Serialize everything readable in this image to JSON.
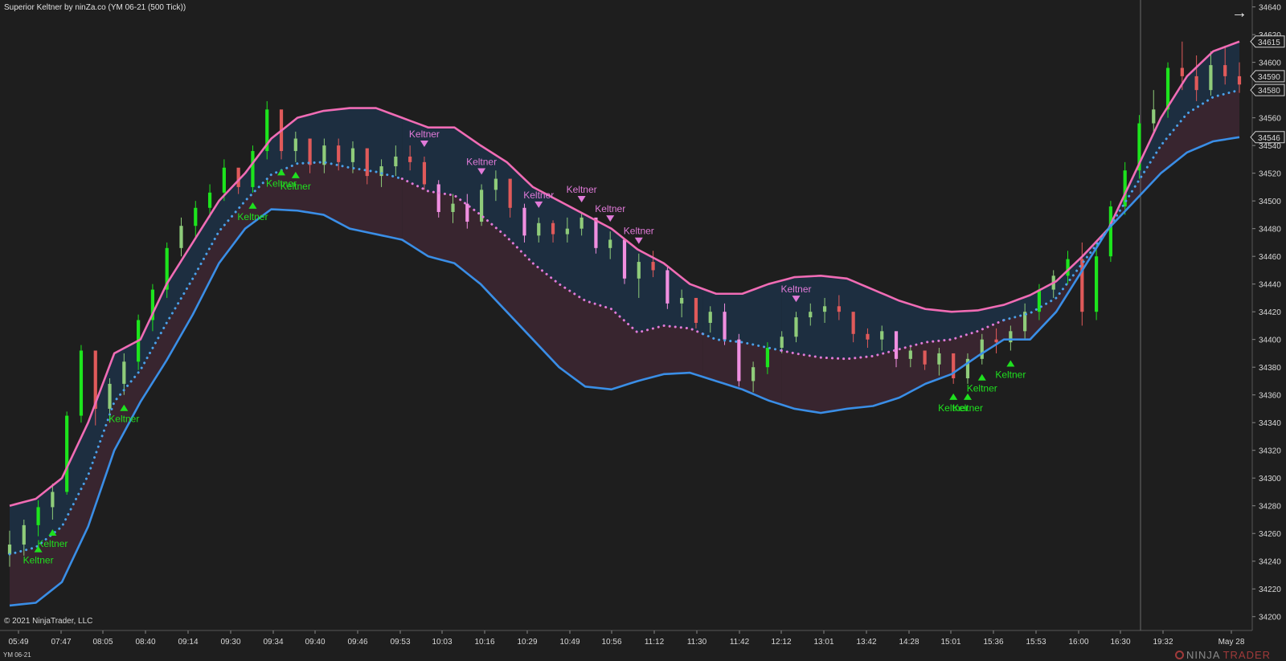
{
  "window": {
    "title": "Superior Keltner by ninZa.co (YM 06-21 (500 Tick))",
    "copyright": "© 2021 NinjaTrader, LLC",
    "instrument": "YM 06-21",
    "brand": {
      "ninja": "NINJA",
      "trader": "TRADER"
    },
    "nav_icon": "arrow-right-icon"
  },
  "colors": {
    "background": "#1e1e1e",
    "upper_band": "#f06cb5",
    "lower_band": "#3a8ee6",
    "midline": "#4aa0e8",
    "up_fill": "#1e2f42",
    "down_fill": "#3a2630",
    "bull_impulse": "#1de41d",
    "bull_weak": "#8fcc7a",
    "bear_impulse": "#f08fe0",
    "bear_weak": "#e05a5a",
    "buy_marker": "#1fe01f",
    "sell_marker": "#e07ad8"
  },
  "chart_data": {
    "type": "candlestick",
    "title": "Superior Keltner by ninZa.co (YM 06-21 (500 Tick))",
    "y_axis": {
      "ticks": [
        34640,
        34620,
        34600,
        34580,
        34560,
        34540,
        34520,
        34500,
        34480,
        34460,
        34440,
        34420,
        34400,
        34380,
        34360,
        34340,
        34320,
        34300,
        34280,
        34260,
        34240,
        34220,
        34200
      ],
      "range": [
        34190,
        34645
      ]
    },
    "x_axis": {
      "labels": [
        "05:49",
        "07:47",
        "08:05",
        "08:40",
        "09:14",
        "09:30",
        "09:34",
        "09:40",
        "09:46",
        "09:53",
        "10:03",
        "10:16",
        "10:29",
        "10:49",
        "10:56",
        "11:12",
        "11:30",
        "11:42",
        "12:12",
        "13:01",
        "13:42",
        "14:28",
        "15:01",
        "15:36",
        "15:53",
        "16:00",
        "16:30",
        "19:32",
        "May 28"
      ]
    },
    "price_flags": [
      34615,
      34590,
      34580,
      34546
    ],
    "upper_band": [
      [
        0,
        34280
      ],
      [
        2,
        34285
      ],
      [
        4,
        34300
      ],
      [
        6,
        34340
      ],
      [
        8,
        34390
      ],
      [
        10,
        34400
      ],
      [
        12,
        34440
      ],
      [
        14,
        34470
      ],
      [
        16,
        34500
      ],
      [
        18,
        34520
      ],
      [
        20,
        34545
      ],
      [
        22,
        34560
      ],
      [
        24,
        34565
      ],
      [
        26,
        34567
      ],
      [
        28,
        34567
      ],
      [
        30,
        34560
      ],
      [
        32,
        34553
      ],
      [
        34,
        34553
      ],
      [
        36,
        34540
      ],
      [
        38,
        34528
      ],
      [
        40,
        34510
      ],
      [
        42,
        34500
      ],
      [
        44,
        34490
      ],
      [
        46,
        34480
      ],
      [
        48,
        34465
      ],
      [
        50,
        34455
      ],
      [
        52,
        34440
      ],
      [
        54,
        34433
      ],
      [
        56,
        34433
      ],
      [
        58,
        34440
      ],
      [
        60,
        34445
      ],
      [
        62,
        34446
      ],
      [
        64,
        34444
      ],
      [
        66,
        34436
      ],
      [
        68,
        34428
      ],
      [
        70,
        34422
      ],
      [
        72,
        34420
      ],
      [
        74,
        34421
      ],
      [
        76,
        34425
      ],
      [
        78,
        34432
      ],
      [
        80,
        34442
      ],
      [
        82,
        34460
      ],
      [
        84,
        34480
      ],
      [
        86,
        34520
      ],
      [
        88,
        34560
      ],
      [
        90,
        34590
      ],
      [
        92,
        34608
      ],
      [
        94,
        34615
      ]
    ],
    "lower_band": [
      [
        0,
        34208
      ],
      [
        2,
        34210
      ],
      [
        4,
        34225
      ],
      [
        6,
        34265
      ],
      [
        8,
        34320
      ],
      [
        10,
        34355
      ],
      [
        12,
        34385
      ],
      [
        14,
        34418
      ],
      [
        16,
        34455
      ],
      [
        18,
        34480
      ],
      [
        20,
        34494
      ],
      [
        22,
        34493
      ],
      [
        24,
        34490
      ],
      [
        26,
        34480
      ],
      [
        28,
        34476
      ],
      [
        30,
        34472
      ],
      [
        32,
        34460
      ],
      [
        34,
        34455
      ],
      [
        36,
        34440
      ],
      [
        38,
        34420
      ],
      [
        40,
        34400
      ],
      [
        42,
        34380
      ],
      [
        44,
        34366
      ],
      [
        46,
        34364
      ],
      [
        48,
        34370
      ],
      [
        50,
        34375
      ],
      [
        52,
        34376
      ],
      [
        54,
        34370
      ],
      [
        56,
        34364
      ],
      [
        58,
        34356
      ],
      [
        60,
        34350
      ],
      [
        62,
        34347
      ],
      [
        64,
        34350
      ],
      [
        66,
        34352
      ],
      [
        68,
        34358
      ],
      [
        70,
        34368
      ],
      [
        72,
        34375
      ],
      [
        74,
        34388
      ],
      [
        76,
        34400
      ],
      [
        78,
        34400
      ],
      [
        80,
        34420
      ],
      [
        82,
        34450
      ],
      [
        84,
        34480
      ],
      [
        86,
        34500
      ],
      [
        88,
        34520
      ],
      [
        90,
        34535
      ],
      [
        92,
        34543
      ],
      [
        94,
        34546
      ]
    ],
    "midline": [
      [
        0,
        34245
      ],
      [
        2,
        34250
      ],
      [
        4,
        34265
      ],
      [
        6,
        34302
      ],
      [
        8,
        34355
      ],
      [
        10,
        34378
      ],
      [
        12,
        34412
      ],
      [
        14,
        34444
      ],
      [
        16,
        34478
      ],
      [
        18,
        34500
      ],
      [
        20,
        34519
      ],
      [
        22,
        34527
      ],
      [
        24,
        34528
      ],
      [
        26,
        34524
      ],
      [
        28,
        34521
      ],
      [
        30,
        34516
      ],
      [
        32,
        34507
      ],
      [
        34,
        34504
      ],
      [
        36,
        34490
      ],
      [
        38,
        34474
      ],
      [
        40,
        34455
      ],
      [
        42,
        34440
      ],
      [
        44,
        34428
      ],
      [
        46,
        34422
      ],
      [
        48,
        34405
      ],
      [
        50,
        34410
      ],
      [
        52,
        34408
      ],
      [
        54,
        34400
      ],
      [
        56,
        34398
      ],
      [
        58,
        34394
      ],
      [
        60,
        34390
      ],
      [
        62,
        34387
      ],
      [
        64,
        34386
      ],
      [
        66,
        34388
      ],
      [
        68,
        34393
      ],
      [
        70,
        34398
      ],
      [
        72,
        34400
      ],
      [
        74,
        34406
      ],
      [
        76,
        34414
      ],
      [
        78,
        34419
      ],
      [
        80,
        34430
      ],
      [
        82,
        34455
      ],
      [
        84,
        34480
      ],
      [
        86,
        34510
      ],
      [
        88,
        34540
      ],
      [
        90,
        34563
      ],
      [
        92,
        34575
      ],
      [
        94,
        34580
      ]
    ],
    "trend_segments": [
      {
        "from": 0,
        "to": 30,
        "trend": "up"
      },
      {
        "from": 30,
        "to": 53,
        "trend": "down"
      },
      {
        "from": 53,
        "to": 59,
        "trend": "up"
      },
      {
        "from": 59,
        "to": 76,
        "trend": "down"
      },
      {
        "from": 76,
        "to": 94,
        "trend": "up"
      }
    ],
    "candles": [
      [
        34245,
        34262,
        34236,
        34252,
        0
      ],
      [
        34252,
        34270,
        34244,
        34266,
        0
      ],
      [
        34266,
        34284,
        34258,
        34279,
        1
      ],
      [
        34279,
        34296,
        34270,
        34290,
        0
      ],
      [
        34290,
        34348,
        34288,
        34345,
        1
      ],
      [
        34345,
        34396,
        34340,
        34392,
        1
      ],
      [
        34392,
        34385,
        34338,
        34350,
        0
      ],
      [
        34350,
        34372,
        34340,
        34368,
        0
      ],
      [
        34368,
        34390,
        34360,
        34384,
        0
      ],
      [
        34384,
        34418,
        34378,
        34414,
        1
      ],
      [
        34414,
        34440,
        34406,
        34436,
        1
      ],
      [
        34436,
        34470,
        34430,
        34466,
        1
      ],
      [
        34466,
        34488,
        34460,
        34482,
        0
      ],
      [
        34482,
        34500,
        34474,
        34495,
        1
      ],
      [
        34495,
        34512,
        34488,
        34506,
        1
      ],
      [
        34506,
        34530,
        34500,
        34524,
        1
      ],
      [
        34524,
        34514,
        34505,
        34510,
        0
      ],
      [
        34510,
        34540,
        34506,
        34536,
        1
      ],
      [
        34536,
        34572,
        34530,
        34566,
        1
      ],
      [
        34566,
        34556,
        34530,
        34536,
        0
      ],
      [
        34536,
        34550,
        34528,
        34545,
        0
      ],
      [
        34545,
        34540,
        34520,
        34526,
        0
      ],
      [
        34526,
        34545,
        34520,
        34540,
        0
      ],
      [
        34540,
        34545,
        34522,
        34528,
        0
      ],
      [
        34528,
        34543,
        34520,
        34538,
        0
      ],
      [
        34538,
        34536,
        34512,
        34518,
        0
      ],
      [
        34518,
        34530,
        34510,
        34525,
        0
      ],
      [
        34525,
        34540,
        34518,
        34532,
        0
      ],
      [
        34532,
        34540,
        34522,
        34528,
        0
      ],
      [
        34528,
        34532,
        34508,
        34512,
        0
      ],
      [
        34512,
        34515,
        34488,
        34492,
        2
      ],
      [
        34492,
        34505,
        34484,
        34498,
        0
      ],
      [
        34498,
        34505,
        34480,
        34485,
        2
      ],
      [
        34485,
        34512,
        34482,
        34508,
        0
      ],
      [
        34508,
        34522,
        34500,
        34516,
        0
      ],
      [
        34516,
        34510,
        34488,
        34495,
        0
      ],
      [
        34495,
        34498,
        34470,
        34475,
        2
      ],
      [
        34475,
        34488,
        34470,
        34484,
        0
      ],
      [
        34484,
        34486,
        34470,
        34476,
        0
      ],
      [
        34476,
        34488,
        34470,
        34480,
        0
      ],
      [
        34480,
        34492,
        34475,
        34488,
        0
      ],
      [
        34488,
        34486,
        34462,
        34466,
        2
      ],
      [
        34466,
        34478,
        34458,
        34472,
        0
      ],
      [
        34472,
        34468,
        34440,
        34444,
        2
      ],
      [
        34444,
        34462,
        34430,
        34456,
        0
      ],
      [
        34456,
        34464,
        34445,
        34450,
        0
      ],
      [
        34450,
        34452,
        34422,
        34426,
        2
      ],
      [
        34426,
        34436,
        34416,
        34430,
        0
      ],
      [
        34430,
        34428,
        34408,
        34412,
        0
      ],
      [
        34412,
        34424,
        34405,
        34420,
        0
      ],
      [
        34420,
        34426,
        34396,
        34400,
        2
      ],
      [
        34400,
        34404,
        34366,
        34370,
        2
      ],
      [
        34370,
        34384,
        34362,
        34380,
        0
      ],
      [
        34380,
        34398,
        34375,
        34394,
        1
      ],
      [
        34394,
        34406,
        34390,
        34402,
        0
      ],
      [
        34402,
        34420,
        34398,
        34416,
        0
      ],
      [
        34416,
        34426,
        34410,
        34420,
        0
      ],
      [
        34420,
        34430,
        34412,
        34424,
        0
      ],
      [
        34424,
        34432,
        34414,
        34420,
        0
      ],
      [
        34420,
        34418,
        34398,
        34404,
        0
      ],
      [
        34404,
        34408,
        34394,
        34400,
        0
      ],
      [
        34400,
        34410,
        34392,
        34406,
        0
      ],
      [
        34406,
        34400,
        34380,
        34386,
        2
      ],
      [
        34386,
        34396,
        34380,
        34392,
        0
      ],
      [
        34392,
        34390,
        34378,
        34382,
        0
      ],
      [
        34382,
        34394,
        34374,
        34390,
        0
      ],
      [
        34390,
        34388,
        34368,
        34372,
        0
      ],
      [
        34372,
        34390,
        34368,
        34386,
        0
      ],
      [
        34386,
        34404,
        34382,
        34400,
        0
      ],
      [
        34400,
        34408,
        34390,
        34398,
        0
      ],
      [
        34398,
        34410,
        34392,
        34406,
        0
      ],
      [
        34406,
        34426,
        34400,
        34420,
        0
      ],
      [
        34420,
        34440,
        34414,
        34436,
        1
      ],
      [
        34436,
        34450,
        34430,
        34446,
        0
      ],
      [
        34446,
        34464,
        34440,
        34458,
        1
      ],
      [
        34458,
        34470,
        34410,
        34420,
        0
      ],
      [
        34420,
        34470,
        34414,
        34460,
        1
      ],
      [
        34460,
        34500,
        34456,
        34496,
        1
      ],
      [
        34496,
        34528,
        34490,
        34522,
        1
      ],
      [
        34522,
        34562,
        34516,
        34556,
        1
      ],
      [
        34556,
        34580,
        34548,
        34566,
        0
      ],
      [
        34566,
        34600,
        34560,
        34596,
        1
      ],
      [
        34596,
        34615,
        34580,
        34590,
        0
      ],
      [
        34590,
        34605,
        34572,
        34580,
        0
      ],
      [
        34580,
        34608,
        34576,
        34598,
        0
      ],
      [
        34598,
        34612,
        34584,
        34590,
        0
      ],
      [
        34590,
        34600,
        34578,
        34584,
        0
      ]
    ],
    "signals": [
      {
        "x": 2,
        "type": "buy",
        "label": "Keltner"
      },
      {
        "x": 3,
        "type": "buy",
        "label": "Keltner"
      },
      {
        "x": 8,
        "type": "buy",
        "label": "Keltner"
      },
      {
        "x": 17,
        "type": "buy",
        "label": "Keltner"
      },
      {
        "x": 19,
        "type": "buy",
        "label": "Keltner"
      },
      {
        "x": 20,
        "type": "buy",
        "label": "Keltner"
      },
      {
        "x": 29,
        "type": "sell",
        "label": "Keltner"
      },
      {
        "x": 33,
        "type": "sell",
        "label": "Keltner"
      },
      {
        "x": 37,
        "type": "sell",
        "label": "Keltner"
      },
      {
        "x": 40,
        "type": "sell",
        "label": "Keltner"
      },
      {
        "x": 42,
        "type": "sell",
        "label": "Keltner"
      },
      {
        "x": 44,
        "type": "sell",
        "label": "Keltner"
      },
      {
        "x": 55,
        "type": "sell",
        "label": "Keltner"
      },
      {
        "x": 66,
        "type": "buy",
        "label": "Keltner"
      },
      {
        "x": 67,
        "type": "buy",
        "label": "Keltner"
      },
      {
        "x": 68,
        "type": "buy",
        "label": "Keltner"
      },
      {
        "x": 70,
        "type": "buy",
        "label": "Keltner"
      }
    ],
    "crosshair_at": "16:30"
  }
}
